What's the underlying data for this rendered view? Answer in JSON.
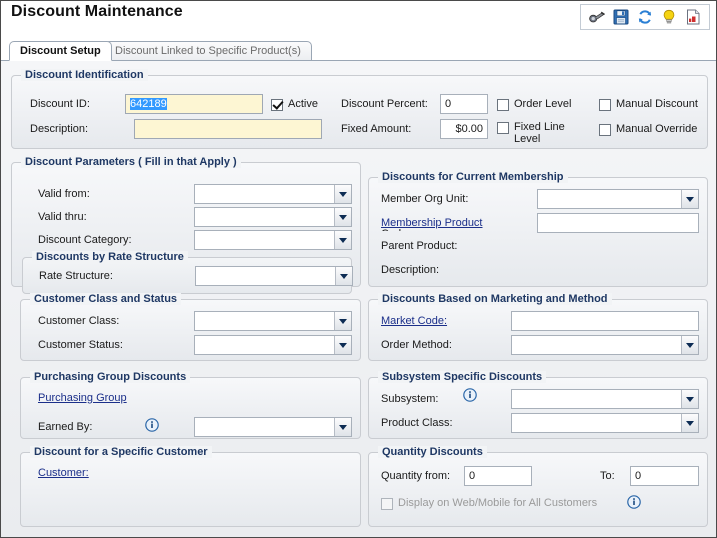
{
  "header": {
    "title": "Discount Maintenance",
    "toolbar": [
      {
        "name": "binoculars-icon",
        "label": "Search"
      },
      {
        "name": "save-icon",
        "label": "Save"
      },
      {
        "name": "refresh-icon",
        "label": "Refresh"
      },
      {
        "name": "lightbulb-icon",
        "label": "Hints"
      },
      {
        "name": "report-icon",
        "label": "Report"
      }
    ]
  },
  "tabs": [
    {
      "label": "Discount Setup",
      "active": true
    },
    {
      "label": "Discount Linked to Specific Product(s)",
      "active": false
    }
  ],
  "identification": {
    "legend": "Discount Identification",
    "discount_id_label": "Discount ID:",
    "discount_id_value": "642189",
    "description_label": "Description:",
    "description_value": "",
    "active_label": "Active",
    "active_checked": true,
    "discount_percent_label": "Discount Percent:",
    "discount_percent_value": "0",
    "fixed_amount_label": "Fixed Amount:",
    "fixed_amount_value": "$0.00",
    "order_level_label": "Order Level",
    "order_level_checked": false,
    "fixed_line_level_label": "Fixed Line Level",
    "fixed_line_level_checked": false,
    "manual_discount_label": "Manual Discount",
    "manual_discount_checked": false,
    "manual_override_label": "Manual Override",
    "manual_override_checked": false
  },
  "parameters": {
    "legend": "Discount Parameters ( Fill in that Apply )",
    "valid_from_label": "Valid from:",
    "valid_from_value": "",
    "valid_thru_label": "Valid thru:",
    "valid_thru_value": "",
    "discount_category_label": "Discount Category:",
    "discount_category_value": ""
  },
  "rate_structure": {
    "legend": "Discounts by Rate Structure",
    "rate_structure_label": "Rate Structure:",
    "rate_structure_value": ""
  },
  "customer_class": {
    "legend": "Customer Class and Status",
    "customer_class_label": "Customer Class:",
    "customer_class_value": "",
    "customer_status_label": "Customer Status:",
    "customer_status_value": ""
  },
  "purchasing_group": {
    "legend": "Purchasing Group Discounts",
    "purchasing_group_link": "Purchasing Group",
    "earned_by_label": "Earned By:",
    "earned_by_value": "",
    "info_icon": "info-icon"
  },
  "specific_customer": {
    "legend": "Discount for a Specific Customer",
    "customer_link": "Customer:"
  },
  "membership": {
    "legend": "Discounts for Current Membership",
    "member_org_unit_label": "Member Org Unit:",
    "member_org_unit_value": "",
    "membership_product_link": "Membership Product",
    "membership_product_sub": "Code:",
    "membership_product_value": "",
    "parent_product_label": "Parent Product:",
    "description_label": "Description:"
  },
  "marketing": {
    "legend": "Discounts Based on Marketing and Method",
    "market_code_link": "Market Code:",
    "market_code_value": "",
    "order_method_label": "Order Method:",
    "order_method_value": ""
  },
  "subsystem": {
    "legend": "Subsystem Specific Discounts",
    "subsystem_label": "Subsystem:",
    "subsystem_value": "",
    "product_class_label": "Product Class:",
    "product_class_value": "",
    "info_icon": "info-icon"
  },
  "quantity": {
    "legend": "Quantity Discounts",
    "quantity_from_label": "Quantity from:",
    "quantity_from_value": "0",
    "to_label": "To:",
    "to_value": "0",
    "display_web_label": "Display on Web/Mobile for All Customers",
    "display_web_checked": false,
    "info_icon": "info-icon"
  },
  "colors": {
    "accent": "#1f3864",
    "link": "#1b2f8a",
    "field_yellow": "#fdf6d3",
    "selection_blue": "#3399ff"
  }
}
